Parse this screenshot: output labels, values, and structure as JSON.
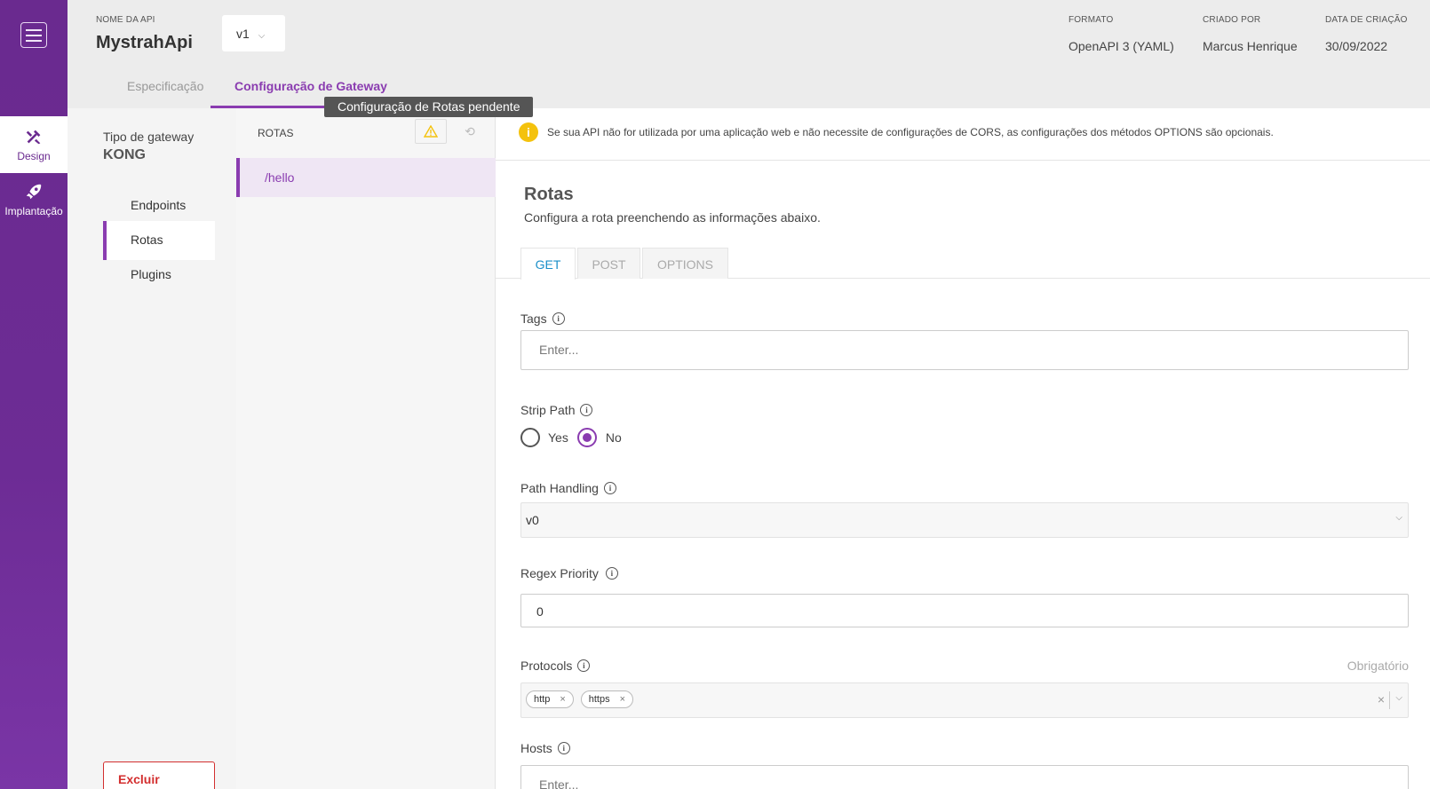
{
  "rail": {
    "items": [
      {
        "label": "Design"
      },
      {
        "label": "Implantação"
      }
    ]
  },
  "header": {
    "api_name_label": "NOME DA API",
    "api_name": "MystrahApi",
    "version": "v1",
    "format_label": "FORMATO",
    "format_value": "OpenAPI 3 (YAML)",
    "created_by_label": "CRIADO POR",
    "created_by_value": "Marcus Henrique",
    "created_date_label": "DATA DE CRIAÇÃO",
    "created_date_value": "30/09/2022",
    "tabs": [
      {
        "label": "Especificação"
      },
      {
        "label": "Configuração de Gateway"
      }
    ],
    "tooltip": "Configuração de Rotas pendente"
  },
  "gateway": {
    "type_label": "Tipo de gateway",
    "type_value": "KONG",
    "items": [
      {
        "label": "Endpoints"
      },
      {
        "label": "Rotas"
      },
      {
        "label": "Plugins"
      }
    ],
    "delete_label": "Excluir"
  },
  "routes": {
    "heading": "ROTAS",
    "items": [
      {
        "path": "/hello"
      }
    ]
  },
  "main": {
    "notice": "Se sua API não for utilizada por uma aplicação web e não necessite de configurações de CORS, as configurações dos métodos OPTIONS são opcionais.",
    "title": "Rotas",
    "subtitle": "Configura a rota preenchendo as informações abaixo.",
    "method_tabs": [
      {
        "label": "GET"
      },
      {
        "label": "POST"
      },
      {
        "label": "OPTIONS"
      }
    ],
    "tags": {
      "label": "Tags",
      "placeholder": "Enter..."
    },
    "strip_path": {
      "label": "Strip Path",
      "yes": "Yes",
      "no": "No",
      "selected": "No"
    },
    "path_handling": {
      "label": "Path Handling",
      "value": "v0"
    },
    "regex_priority": {
      "label": "Regex Priority",
      "value": "0"
    },
    "protocols": {
      "label": "Protocols",
      "required": "Obrigatório",
      "chips": [
        "http",
        "https"
      ]
    },
    "hosts": {
      "label": "Hosts",
      "placeholder": "Enter..."
    }
  },
  "colors": {
    "brand": "#6a2a8f",
    "accent": "#8a3cb0",
    "tab_active": "#1a8fc9",
    "warning": "#f4c20d",
    "danger": "#d32f2f"
  }
}
